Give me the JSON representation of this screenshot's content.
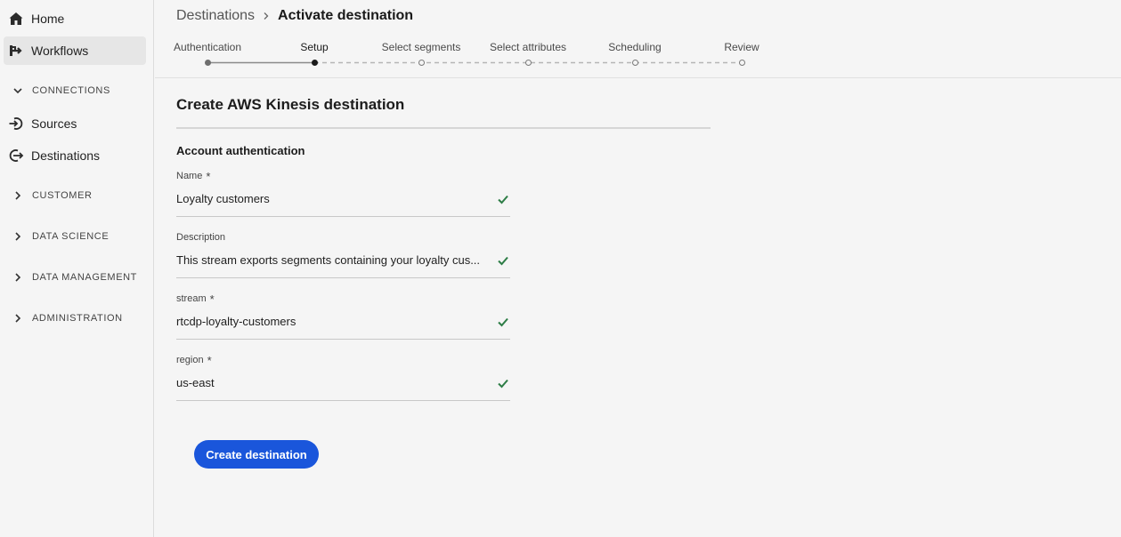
{
  "sidebar": {
    "home": "Home",
    "workflows": "Workflows",
    "connections": "CONNECTIONS",
    "sources": "Sources",
    "destinations": "Destinations",
    "customer": "CUSTOMER",
    "data_science": "DATA SCIENCE",
    "data_management": "DATA MANAGEMENT",
    "administration": "ADMINISTRATION"
  },
  "breadcrumb": {
    "parent": "Destinations",
    "current": "Activate destination"
  },
  "steps": [
    {
      "label": "Authentication",
      "state": "done"
    },
    {
      "label": "Setup",
      "state": "current"
    },
    {
      "label": "Select segments",
      "state": "todo"
    },
    {
      "label": "Select attributes",
      "state": "todo"
    },
    {
      "label": "Scheduling",
      "state": "todo"
    },
    {
      "label": "Review",
      "state": "todo"
    }
  ],
  "form": {
    "title": "Create AWS Kinesis destination",
    "section": "Account authentication",
    "fields": [
      {
        "label": "Name",
        "required": true,
        "value": "Loyalty customers"
      },
      {
        "label": "Description",
        "required": false,
        "value": "This stream exports segments containing your loyalty cus..."
      },
      {
        "label": "stream",
        "required": true,
        "value": "rtcdp-loyalty-customers"
      },
      {
        "label": "region",
        "required": true,
        "value": "us-east"
      }
    ],
    "required_marker": "*",
    "submit_label": "Create destination"
  },
  "colors": {
    "accent": "#1a56db",
    "valid": "#2d7d46",
    "step_done": "#6e6e6e",
    "step_current": "#1a1a1a"
  }
}
